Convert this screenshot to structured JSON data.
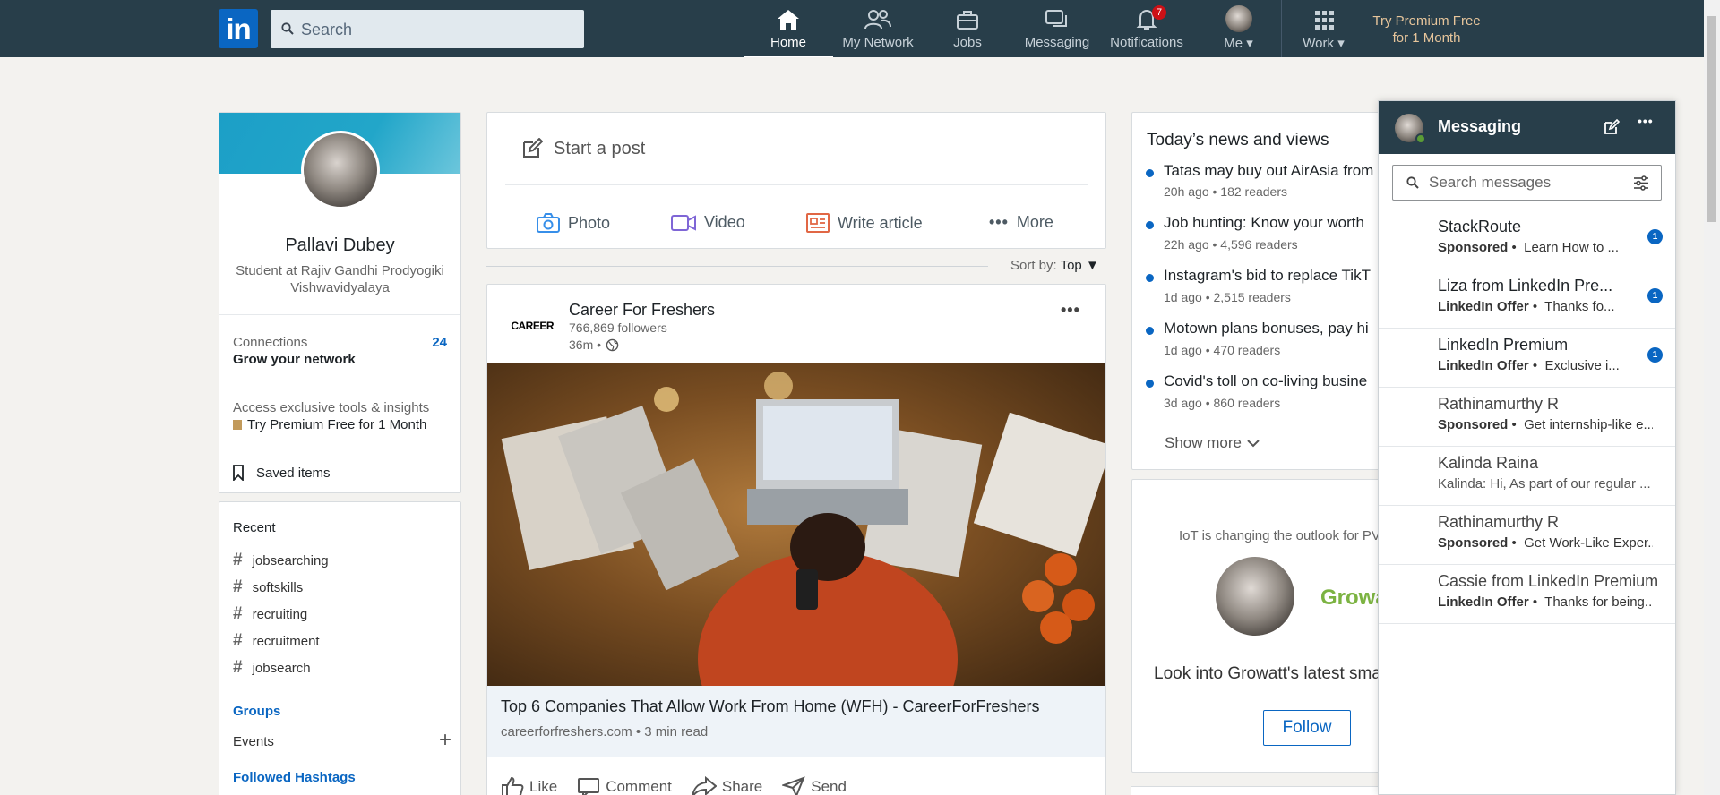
{
  "nav": {
    "logo": "in",
    "search_placeholder": "Search",
    "items": [
      {
        "label": "Home"
      },
      {
        "label": "My Network"
      },
      {
        "label": "Jobs"
      },
      {
        "label": "Messaging"
      },
      {
        "label": "Notifications",
        "badge": "7"
      },
      {
        "label": "Me"
      },
      {
        "label": "Work"
      }
    ],
    "premium_line1": "Try Premium Free",
    "premium_line2": "for 1 Month"
  },
  "profile": {
    "name": "Pallavi Dubey",
    "headline_line1": "Student at Rajiv Gandhi Prodyogiki",
    "headline_line2": "Vishwavidyalaya",
    "connections_label": "Connections",
    "connections_count": "24",
    "grow_network": "Grow your network",
    "exclusive_tools": "Access exclusive tools & insights",
    "premium_cta": "Try Premium Free for 1 Month",
    "saved_items": "Saved items"
  },
  "recent": {
    "title": "Recent",
    "hashtags": [
      "jobsearching",
      "softskills",
      "recruiting",
      "recruitment",
      "jobsearch"
    ],
    "groups": "Groups",
    "events": "Events",
    "followed_hashtags": "Followed Hashtags"
  },
  "composer": {
    "start_post": "Start a post",
    "photo": "Photo",
    "video": "Video",
    "write_article": "Write article",
    "more": "More"
  },
  "sort": {
    "label": "Sort by:",
    "value": "Top"
  },
  "post": {
    "author": "Career For Freshers",
    "logo_text": "CAREER",
    "followers": "766,869 followers",
    "time": "36m •",
    "link_title": "Top 6 Companies That Allow Work From Home (WFH) - CareerForFreshers",
    "link_meta": "careerforfreshers.com • 3 min read",
    "actions": [
      "Like",
      "Comment",
      "Share",
      "Send"
    ]
  },
  "news": {
    "title": "Today’s news and views",
    "items": [
      {
        "headline": "Tatas may buy out AirAsia from",
        "meta": "20h ago • 182 readers"
      },
      {
        "headline": "Job hunting: Know your worth",
        "meta": "22h ago • 4,596 readers"
      },
      {
        "headline": "Instagram's bid to replace TikT",
        "meta": "1d ago • 2,515 readers"
      },
      {
        "headline": "Motown plans bonuses, pay hi",
        "meta": "1d ago • 470 readers"
      },
      {
        "headline": "Covid's toll on co-living busine",
        "meta": "3d ago • 860 readers"
      }
    ],
    "show_more": "Show more"
  },
  "ad": {
    "tagline": "IoT is changing the outlook for PV",
    "brand": "Growa",
    "text": "Look into Growatt's latest sma",
    "follow": "Follow"
  },
  "messaging": {
    "title": "Messaging",
    "search_placeholder": "Search messages",
    "conversations": [
      {
        "name": "StackRoute",
        "tag": "Sponsored",
        "preview": "Learn How to ...",
        "unread": "1"
      },
      {
        "name": "Liza from LinkedIn Pre...",
        "tag": "LinkedIn Offer",
        "preview": "Thanks fo...",
        "unread": "1"
      },
      {
        "name": "LinkedIn Premium",
        "tag": "LinkedIn Offer",
        "preview": "Exclusive i...",
        "unread": "1"
      },
      {
        "name": "Rathinamurthy R",
        "tag": "Sponsored",
        "preview": "Get internship-like e..."
      },
      {
        "name": "Kalinda Raina",
        "tag": "",
        "preview": "Kalinda: Hi, As part of our regular ..."
      },
      {
        "name": "Rathinamurthy R",
        "tag": "Sponsored",
        "preview": "Get Work-Like Exper..."
      },
      {
        "name": "Cassie from LinkedIn Premium",
        "tag": "LinkedIn Offer",
        "preview": "Thanks for being..."
      }
    ]
  }
}
